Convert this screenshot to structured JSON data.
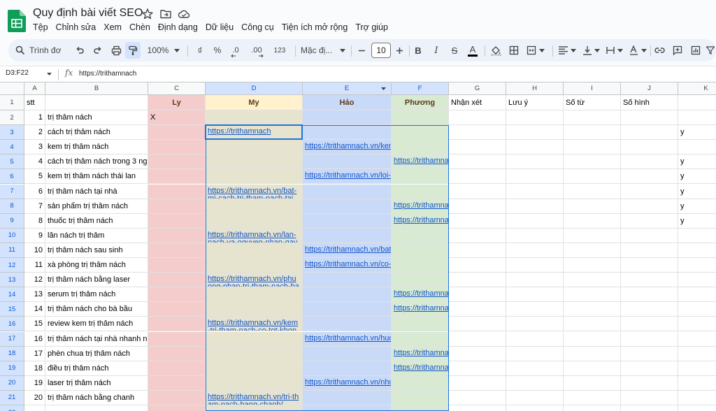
{
  "document": {
    "title": "Quy định bài viết SEO"
  },
  "title_icons": [
    "star-icon",
    "move-folder-icon",
    "cloud-status-icon"
  ],
  "menu": [
    "Tệp",
    "Chỉnh sửa",
    "Xem",
    "Chèn",
    "Định dạng",
    "Dữ liệu",
    "Công cụ",
    "Tiện ích mở rộng",
    "Trợ giúp"
  ],
  "toolbar": {
    "search_label": "Trình đơ",
    "zoom": "100%",
    "currency": "₫",
    "percent": "%",
    "decrease_decimal": ".0",
    "increase_decimal": ".00",
    "number_format": "123",
    "font_name": "Mặc đị...",
    "font_size": "10",
    "bold": "B",
    "italic": "I",
    "strikethrough": "S",
    "text_color": "A"
  },
  "formula_bar": {
    "name_box": "D3:F22",
    "fx": "fx",
    "value": "https://trithamnach"
  },
  "selection": {
    "active_cell": "D3",
    "range": "D3:F22",
    "selected_columns": [
      "D",
      "E",
      "F"
    ]
  },
  "colors": {
    "col_c": "#f4cccc",
    "col_d": "#e6e4cf",
    "col_e": "#c9daf8",
    "col_f": "#d9ead3",
    "header_c": "#f4cccc",
    "header_d": "#fff2cc",
    "header_e": "#c9daf8",
    "header_f": "#d9ead3",
    "accent": "#1a73e8",
    "link": "#1155cc"
  },
  "sheet": {
    "columns": [
      "A",
      "B",
      "C",
      "D",
      "E",
      "F",
      "G",
      "H",
      "I",
      "J",
      "K"
    ],
    "row_numbers": [
      "1",
      "2",
      "3",
      "4",
      "5",
      "6",
      "7",
      "8",
      "9",
      "10",
      "11",
      "12",
      "13",
      "14",
      "15",
      "16",
      "17",
      "18",
      "19",
      "20",
      "21",
      "22"
    ],
    "header_row": {
      "A": "stt",
      "B": "",
      "C": "Ly",
      "D": "My",
      "E": "Hảo",
      "F": "Phương",
      "G": "Nhận xét",
      "H": "Lưu ý",
      "I": "Số từ",
      "J": "Số hình",
      "K": ""
    },
    "rows": [
      {
        "A": "1",
        "B": "trị thâm nách",
        "C": "X",
        "D": "",
        "E": "",
        "F": "",
        "K": ""
      },
      {
        "A": "2",
        "B": "cách trị thâm nách",
        "C": "",
        "D": "https://trithamnach",
        "E": "",
        "F": "",
        "K": "y"
      },
      {
        "A": "3",
        "B": "kem trị thâm nách",
        "C": "",
        "D": "",
        "E": "https://trithamnach.vn/ken",
        "F": "",
        "K": ""
      },
      {
        "A": "4",
        "B": "cách trị thâm nách trong 3 ng",
        "C": "",
        "D": "",
        "E": "",
        "F": "https://trithamna",
        "K": "y"
      },
      {
        "A": "5",
        "B": "kem trị thâm nách thái lan",
        "C": "",
        "D": "",
        "E": "https://trithamnach.vn/loi-i",
        "F": "",
        "K": "y"
      },
      {
        "A": "6",
        "B": "trị thâm nách tại nhà",
        "C": "",
        "D": "https://trithamnach.vn/bat-mi-cach-tri-tham-nach-tai",
        "E": "",
        "F": "",
        "K": "y"
      },
      {
        "A": "7",
        "B": "sản phẩm trị thâm nách",
        "C": "",
        "D": "",
        "E": "",
        "F": "https://trithamna",
        "K": "y"
      },
      {
        "A": "8",
        "B": "thuốc trị thâm nách",
        "C": "",
        "D": "",
        "E": "",
        "F": "https://trithamna",
        "K": "y"
      },
      {
        "A": "9",
        "B": "lăn nách trị thâm",
        "C": "",
        "D": "https://trithamnach.vn/lan-nach-va-nguyen-nhan-gay",
        "E": "",
        "F": "",
        "K": ""
      },
      {
        "A": "10",
        "B": "trị thâm nách sau sinh",
        "C": "",
        "D": "",
        "E": "https://trithamnach.vn/bat",
        "F": "",
        "K": ""
      },
      {
        "A": "11",
        "B": "xà phòng trị thâm nách",
        "C": "",
        "D": "",
        "E": "https://trithamnach.vn/co-",
        "F": "",
        "K": ""
      },
      {
        "A": "12",
        "B": "trị thâm nách bằng laser",
        "C": "",
        "D": "https://trithamnach.vn/phuong-phap-tri-tham-nach-bang",
        "E": "",
        "F": "",
        "K": ""
      },
      {
        "A": "13",
        "B": "serum trị thâm nách",
        "C": "",
        "D": "",
        "E": "",
        "F": "https://trithamna",
        "K": ""
      },
      {
        "A": "14",
        "B": "trị thâm nách cho bà bầu",
        "C": "",
        "D": "",
        "E": "",
        "F": "https://trithamna",
        "K": ""
      },
      {
        "A": "15",
        "B": "review kem trị thâm nách",
        "C": "",
        "D": "https://trithamnach.vn/kem-tri-tham-nach-co-tot-khong",
        "E": "",
        "F": "",
        "K": ""
      },
      {
        "A": "16",
        "B": "trị thâm nách tại nhà nhanh n",
        "C": "",
        "D": "",
        "E": "https://trithamnach.vn/huo",
        "F": "",
        "K": ""
      },
      {
        "A": "17",
        "B": "phèn chua trị thâm nách",
        "C": "",
        "D": "",
        "E": "",
        "F": "https://trithamna",
        "K": ""
      },
      {
        "A": "18",
        "B": "điều trị thâm nách",
        "C": "",
        "D": "",
        "E": "",
        "F": "https://trithamna",
        "K": ""
      },
      {
        "A": "19",
        "B": "laser trị thâm nách",
        "C": "",
        "D": "",
        "E": "https://trithamnach.vn/nhu",
        "F": "",
        "K": ""
      },
      {
        "A": "20",
        "B": "trị thâm nách bằng chanh",
        "C": "",
        "D": "https://trithamnach.vn/tri-tham-nach-bang-chanh/",
        "E": "",
        "F": "",
        "K": ""
      },
      {
        "A": "",
        "B": "",
        "C": "",
        "D": "",
        "E": "",
        "F": "",
        "K": ""
      }
    ]
  }
}
